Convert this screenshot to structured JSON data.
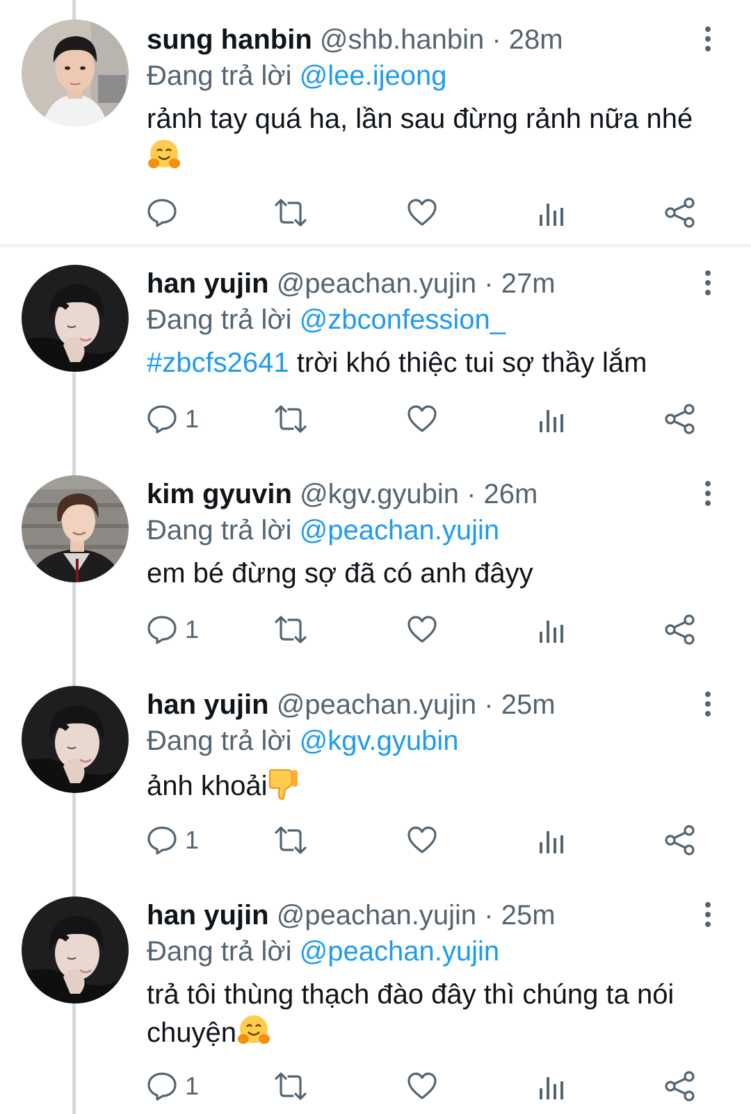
{
  "tweets": [
    {
      "name": "sung hanbin",
      "handle": "@shb.hanbin",
      "separator": "·",
      "time": "28m",
      "reply_prefix": "Đang trả lời",
      "reply_to": "@lee.ijeong",
      "text": "rảnh tay quá ha, lần sau đừng rảnh nữa nhé",
      "hashtag": "",
      "emoji": "hugging-face-emoji",
      "reply_count": ""
    },
    {
      "name": "han yujin",
      "handle": "@peachan.yujin",
      "separator": "·",
      "time": "27m",
      "reply_prefix": "Đang trả lời",
      "reply_to": "@zbconfession_",
      "hashtag": "#zbcfs2641",
      "text": "trời khó thiệc tui sợ thầy lắm",
      "reply_count": "1"
    },
    {
      "name": "kim gyuvin",
      "handle": "@kgv.gyubin",
      "separator": "·",
      "time": "26m",
      "reply_prefix": "Đang trả lời",
      "reply_to": "@peachan.yujin",
      "hashtag": "",
      "text": "em bé đừng sợ đã có anh đâyy",
      "reply_count": "1"
    },
    {
      "name": "han yujin",
      "handle": "@peachan.yujin",
      "separator": "·",
      "time": "25m",
      "reply_prefix": "Đang trả lời",
      "reply_to": "@kgv.gyubin",
      "hashtag": "",
      "text": "ảnh khoải",
      "emoji": "thumbs-down-emoji",
      "reply_count": "1"
    },
    {
      "name": "han yujin",
      "handle": "@peachan.yujin",
      "separator": "·",
      "time": "25m",
      "reply_prefix": "Đang trả lời",
      "reply_to": "@peachan.yujin",
      "hashtag": "",
      "text": "trả tôi thùng thạch đào đây thì chúng ta nói chuyện",
      "emoji": "hugging-face-emoji",
      "reply_count": "1"
    }
  ],
  "colors": {
    "text": "#0f1419",
    "secondary": "#536471",
    "link": "#1d9bf0",
    "thread_line": "#cfd9de",
    "separator": "#eff3f4",
    "icon": "#536471"
  },
  "icons": [
    "reply-icon",
    "retweet-icon",
    "like-icon",
    "views-icon",
    "share-icon",
    "more-icon"
  ]
}
